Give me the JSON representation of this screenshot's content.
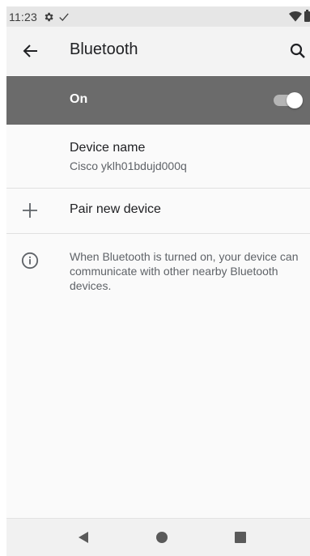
{
  "status_bar": {
    "time": "11:23",
    "icons": [
      "gear-icon",
      "check-icon",
      "wifi-icon",
      "battery-icon"
    ]
  },
  "app_bar": {
    "title": "Bluetooth",
    "back_icon": "arrow-left-icon",
    "search_icon": "search-icon"
  },
  "master_switch": {
    "label": "On",
    "checked": true,
    "background": "#6b6b6b"
  },
  "device_name": {
    "title": "Device name",
    "value": "Cisco yklh01bdujd000q"
  },
  "pair_new_device": {
    "label": "Pair new device",
    "icon": "plus-icon"
  },
  "info": {
    "icon": "info-icon",
    "text": "When Bluetooth is turned on, your device can communicate with other nearby Bluetooth devices."
  },
  "nav_bar": {
    "icons": [
      "back-triangle-icon",
      "home-circle-icon",
      "recents-square-icon"
    ]
  }
}
